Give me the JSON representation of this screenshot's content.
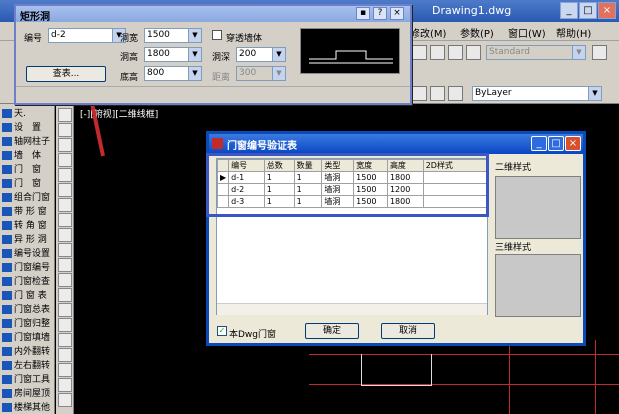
{
  "app": {
    "title": "Drawing1.dwg",
    "menu": [
      "修改(M)",
      "参数(P)",
      "窗口(W)",
      "帮助(H)"
    ],
    "viewport_label": "[-][俯视][二维线框]",
    "style_select": "Standard",
    "layer_select": "ByLayer"
  },
  "left_panel": {
    "items": [
      "天.",
      "设　置",
      "轴网柱子",
      "墙　体",
      "门　窗",
      "门　窗",
      "组合门窗",
      "带 形 窗",
      "转 角 窗",
      "异 形 洞",
      "编号设置",
      "门窗编号",
      "门窗检查",
      "门 窗 表",
      "门窗总表",
      "门窗归整",
      "门窗填墙",
      "内外翻转",
      "左右翻转",
      "门窗工具",
      "房间屋顶",
      "楼梯其他"
    ]
  },
  "rect_palette": {
    "title": "矩形洞",
    "header_buttons": [
      "▪",
      "?",
      "×"
    ],
    "number_label": "编号",
    "number_value": "d-2",
    "width_label": "洞宽",
    "width_value": "1500",
    "height_label": "洞高",
    "height_value": "1800",
    "sill_label": "底高",
    "sill_value": "800",
    "through_wall_label": "穿透墙体",
    "depth_label": "洞深",
    "depth_value": "200",
    "distance_label": "距离",
    "distance_value": "300",
    "lookup_button": "查表..."
  },
  "dialog": {
    "title": "门窗编号验证表",
    "columns": [
      "编号",
      "总数",
      "数量",
      "类型",
      "宽度",
      "高度",
      "2D样式"
    ],
    "rows": [
      {
        "marker": "▶",
        "cells": [
          "d-1",
          "1",
          "1",
          "墙洞",
          "1500",
          "1800",
          ""
        ]
      },
      {
        "marker": "",
        "cells": [
          "d-2",
          "1",
          "1",
          "墙洞",
          "1500",
          "1200",
          ""
        ]
      },
      {
        "marker": "",
        "cells": [
          "d-3",
          "1",
          "1",
          "墙洞",
          "1500",
          "1800",
          ""
        ]
      }
    ],
    "style_2d_label": "二维样式",
    "style_3d_label": "三维样式",
    "checkbox_label": "本Dwg门窗",
    "ok_button": "确定",
    "cancel_button": "取消"
  },
  "colors": {
    "accent": "#0a4ab8",
    "highlight_frame": "#3b57c4",
    "arrow": "#c22b2b"
  }
}
